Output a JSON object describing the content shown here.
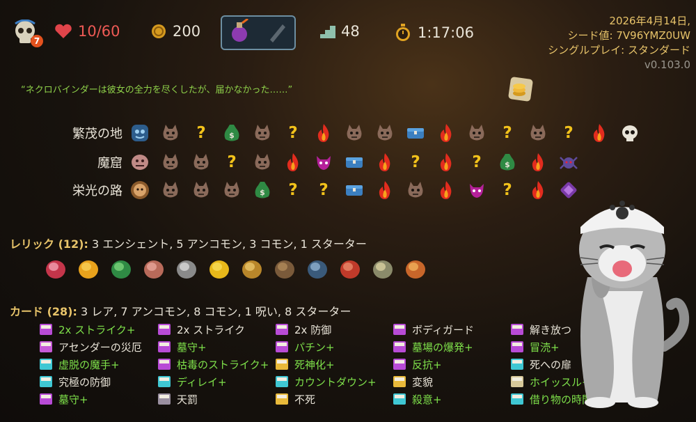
{
  "hud": {
    "ascension": "7",
    "hp": "10/60",
    "gold": "200",
    "floor": "48",
    "time": "1:17:06",
    "date": "2026年4月14日,",
    "seed": "シード値: 7V96YMZ0UW",
    "mode": "シングルプレイ: スタンダード",
    "version": "v0.103.0"
  },
  "quote": "“ネクロバインダーは彼女の全力を尽くしたが、届かなかった……”",
  "acts": [
    {
      "name": "繁茂の地",
      "nodes": [
        "boss-slime",
        "enemy",
        "unknown",
        "treasure-bag",
        "enemy",
        "unknown",
        "rest",
        "enemy",
        "enemy",
        "chest",
        "rest",
        "enemy",
        "unknown",
        "enemy",
        "unknown",
        "rest",
        "boss-skull"
      ]
    },
    {
      "name": "魔窟",
      "nodes": [
        "boss-beast",
        "enemy",
        "enemy",
        "unknown",
        "enemy",
        "rest",
        "elite",
        "chest",
        "rest",
        "unknown",
        "rest",
        "unknown",
        "treasure-bag",
        "rest",
        "boss-spider"
      ]
    },
    {
      "name": "栄光の路",
      "nodes": [
        "boss-lion",
        "enemy",
        "enemy",
        "enemy",
        "treasure-bag",
        "unknown",
        "unknown",
        "chest",
        "rest",
        "enemy",
        "rest",
        "elite",
        "unknown",
        "rest",
        "boss-gem"
      ]
    }
  ],
  "relics": {
    "label": "レリック (12):",
    "summary": "3 エンシェント, 5 アンコモン, 3 コモン, 1 スターター",
    "items": [
      "heart-relic",
      "gold-orb-relic",
      "green-dragon-relic",
      "meat-relic",
      "sickle-relic",
      "banana-relic",
      "crown-relic",
      "boot-relic",
      "box-relic",
      "nunchaku-relic",
      "candelabra-relic",
      "drum-relic"
    ]
  },
  "cards": {
    "label": "カード (28):",
    "summary": "3 レア, 7 アンコモン, 8 コモン, 1 呪い, 8 スターター",
    "items": [
      {
        "name": "2x ストライク+",
        "up": true,
        "color": "#b84bd6"
      },
      {
        "name": "2x ストライク",
        "up": false,
        "color": "#b84bd6"
      },
      {
        "name": "2x 防御",
        "up": false,
        "color": "#b84bd6"
      },
      {
        "name": "ボディガード",
        "up": false,
        "color": "#b84bd6"
      },
      {
        "name": "解き放つ",
        "up": false,
        "color": "#b84bd6"
      },
      {
        "name": "アセンダーの災厄",
        "up": false,
        "color": "#c65ad8"
      },
      {
        "name": "墓守+",
        "up": true,
        "color": "#b84bd6"
      },
      {
        "name": "パチン+",
        "up": true,
        "color": "#b84bd6"
      },
      {
        "name": "墓場の爆発+",
        "up": true,
        "color": "#b84bd6"
      },
      {
        "name": "冒涜+",
        "up": true,
        "color": "#b84bd6"
      },
      {
        "name": "虚脱の魔手+",
        "up": true,
        "color": "#3fc7d3"
      },
      {
        "name": "枯毒のストライク+",
        "up": true,
        "color": "#b84bd6"
      },
      {
        "name": "死神化+",
        "up": true,
        "color": "#e8b93a"
      },
      {
        "name": "反抗+",
        "up": true,
        "color": "#b84bd6"
      },
      {
        "name": "死への扉",
        "up": false,
        "color": "#3fc7d3"
      },
      {
        "name": "究極の防御",
        "up": false,
        "color": "#3fc7d3"
      },
      {
        "name": "ディレイ+",
        "up": true,
        "color": "#3fc7d3"
      },
      {
        "name": "カウントダウン+",
        "up": true,
        "color": "#3fc7d3"
      },
      {
        "name": "変貌",
        "up": false,
        "color": "#e8b93a"
      },
      {
        "name": "ホイッスル+",
        "up": true,
        "color": "#d8c99a"
      },
      {
        "name": "墓守+",
        "up": true,
        "color": "#b84bd6"
      },
      {
        "name": "天罰",
        "up": false,
        "color": "#9a8fa0"
      },
      {
        "name": "不死",
        "up": false,
        "color": "#e8b93a"
      },
      {
        "name": "殺意+",
        "up": true,
        "color": "#3fc7d3"
      },
      {
        "name": "借り物の時間+",
        "up": true,
        "color": "#3fc7d3"
      }
    ]
  }
}
